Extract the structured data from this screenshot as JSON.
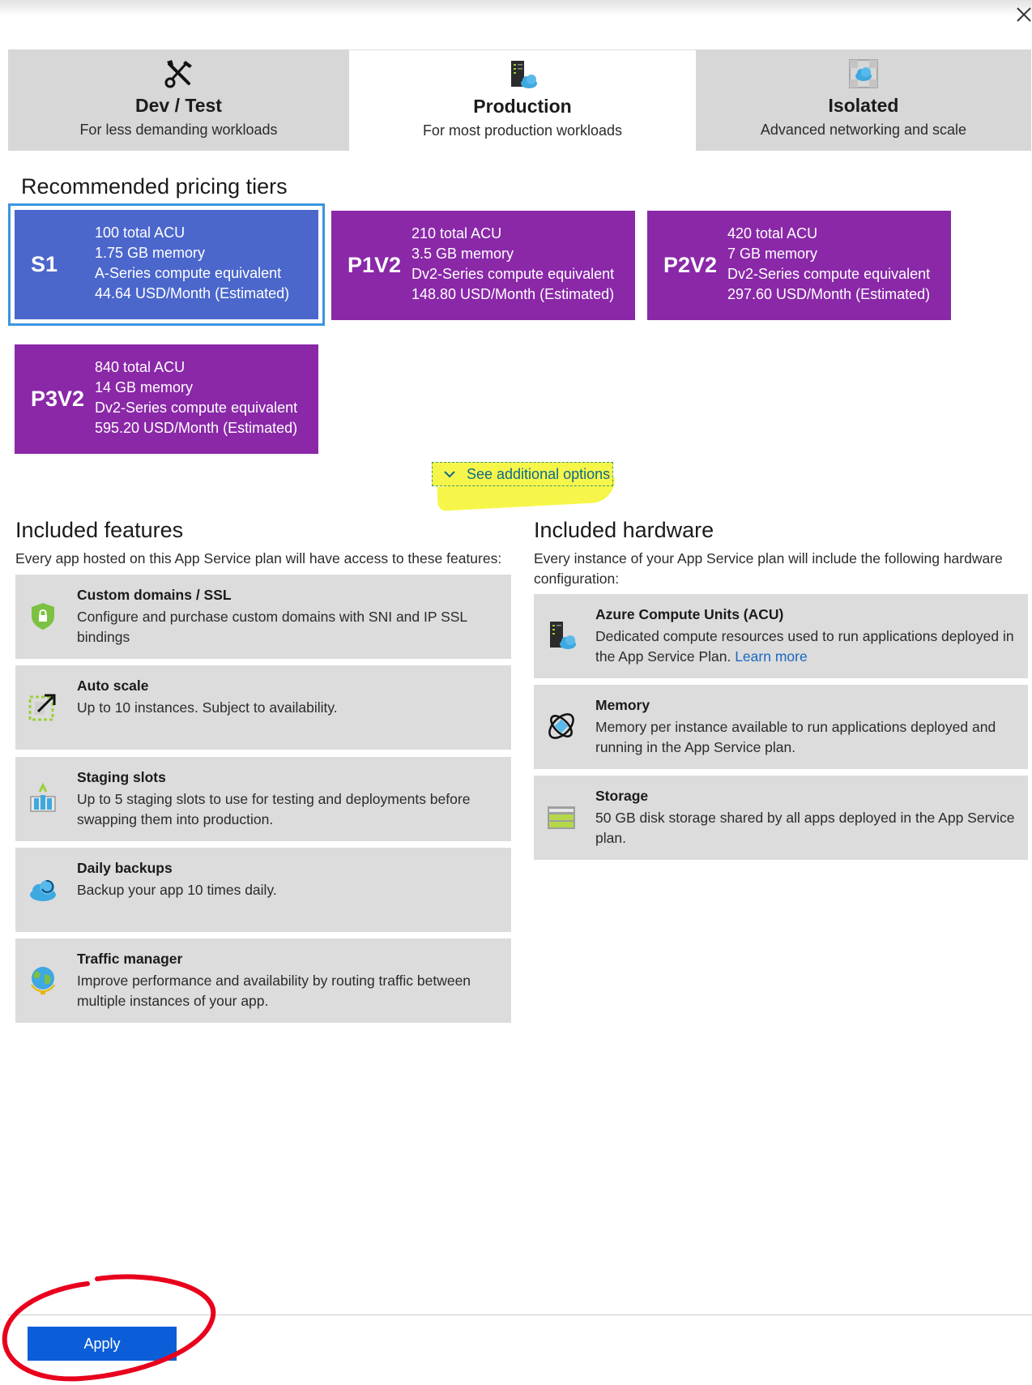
{
  "dialog": {
    "close_icon": "close-icon"
  },
  "tabs": [
    {
      "icon": "tools-icon",
      "title": "Dev / Test",
      "subtitle": "For less demanding workloads",
      "selected": false
    },
    {
      "icon": "server-cloud-icon",
      "title": "Production",
      "subtitle": "For most production workloads",
      "selected": true
    },
    {
      "icon": "isolated-network-icon",
      "title": "Isolated",
      "subtitle": "Advanced networking and scale",
      "selected": false
    }
  ],
  "pricing": {
    "heading": "Recommended pricing tiers",
    "tiers": [
      {
        "name": "S1",
        "acu": "100 total ACU",
        "memory": "1.75 GB memory",
        "compute": "A-Series compute equivalent",
        "price": "44.64 USD/Month (Estimated)",
        "selected": true,
        "color": "#4b67cc"
      },
      {
        "name": "P1V2",
        "acu": "210 total ACU",
        "memory": "3.5 GB memory",
        "compute": "Dv2-Series compute equivalent",
        "price": "148.80 USD/Month (Estimated)",
        "selected": false,
        "color": "#8a28a8"
      },
      {
        "name": "P2V2",
        "acu": "420 total ACU",
        "memory": "7 GB memory",
        "compute": "Dv2-Series compute equivalent",
        "price": "297.60 USD/Month (Estimated)",
        "selected": false,
        "color": "#8a28a8"
      },
      {
        "name": "P3V2",
        "acu": "840 total ACU",
        "memory": "14 GB memory",
        "compute": "Dv2-Series compute equivalent",
        "price": "595.20 USD/Month (Estimated)",
        "selected": false,
        "color": "#8a28a8"
      }
    ],
    "see_more_label": "See additional options"
  },
  "features": {
    "heading": "Included features",
    "description": "Every app hosted on this App Service plan will have access to these features:",
    "items": [
      {
        "icon": "shield-lock-icon",
        "title": "Custom domains / SSL",
        "desc": "Configure and purchase custom domains with SNI and IP SSL bindings"
      },
      {
        "icon": "autoscale-icon",
        "title": "Auto scale",
        "desc": "Up to 10 instances. Subject to availability."
      },
      {
        "icon": "staging-slots-icon",
        "title": "Staging slots",
        "desc": "Up to 5 staging slots to use for testing and deployments before swapping them into production."
      },
      {
        "icon": "cloud-backup-icon",
        "title": "Daily backups",
        "desc": "Backup your app 10 times daily."
      },
      {
        "icon": "globe-icon",
        "title": "Traffic manager",
        "desc": "Improve performance and availability by routing traffic between multiple instances of your app."
      }
    ]
  },
  "hardware": {
    "heading": "Included hardware",
    "description": "Every instance of your App Service plan will include the following hardware configuration:",
    "items": [
      {
        "icon": "server-cloud-icon",
        "title": "Azure Compute Units (ACU)",
        "desc": "Dedicated compute resources used to run applications deployed in the App Service Plan.",
        "link": "Learn more"
      },
      {
        "icon": "memory-icon",
        "title": "Memory",
        "desc": "Memory per instance available to run applications deployed and running in the App Service plan."
      },
      {
        "icon": "storage-icon",
        "title": "Storage",
        "desc": "50 GB disk storage shared by all apps deployed in the App Service plan."
      }
    ]
  },
  "footer": {
    "apply_label": "Apply"
  },
  "colors": {
    "highlight": "#f6f64a",
    "annotation_circle": "#e8001c",
    "apply_button": "#0b5ed7"
  }
}
